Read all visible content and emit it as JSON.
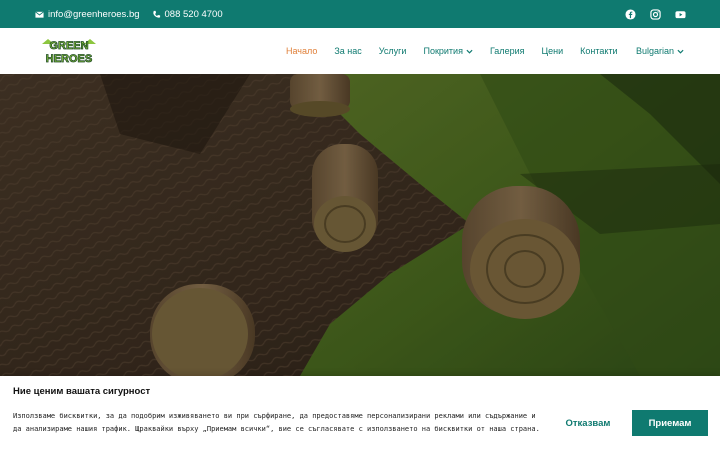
{
  "topbar": {
    "email": "info@greenheroes.bg",
    "phone": "088 520 4700",
    "social_icons": [
      "facebook-icon",
      "instagram-icon",
      "youtube-icon"
    ]
  },
  "header": {
    "logo_text_line1": "GREEN",
    "logo_text_line2": "HEROES",
    "nav": [
      {
        "label": "Начало",
        "active": true
      },
      {
        "label": "За нас"
      },
      {
        "label": "Услуги"
      },
      {
        "label": "Покрития",
        "has_dropdown": true
      },
      {
        "label": "Галерия"
      },
      {
        "label": "Цени"
      },
      {
        "label": "Контакти"
      }
    ],
    "language": "Bulgarian"
  },
  "cookie": {
    "title": "Ние ценим вашата сигурност",
    "text": "Използваме бисквитки, за да подобрим изживяването ви при сърфиране, да предоставяме персонализирани реклами или съдържание и да анализираме нашия трафик. Щраквайки върху „Приемам всички“, вие се съгласявате с използването на бисквитки от наша страна.",
    "reject_label": "Отказвам",
    "accept_label": "Приемам"
  },
  "colors": {
    "brand": "#0f7a70",
    "active_nav": "#e0803a"
  }
}
